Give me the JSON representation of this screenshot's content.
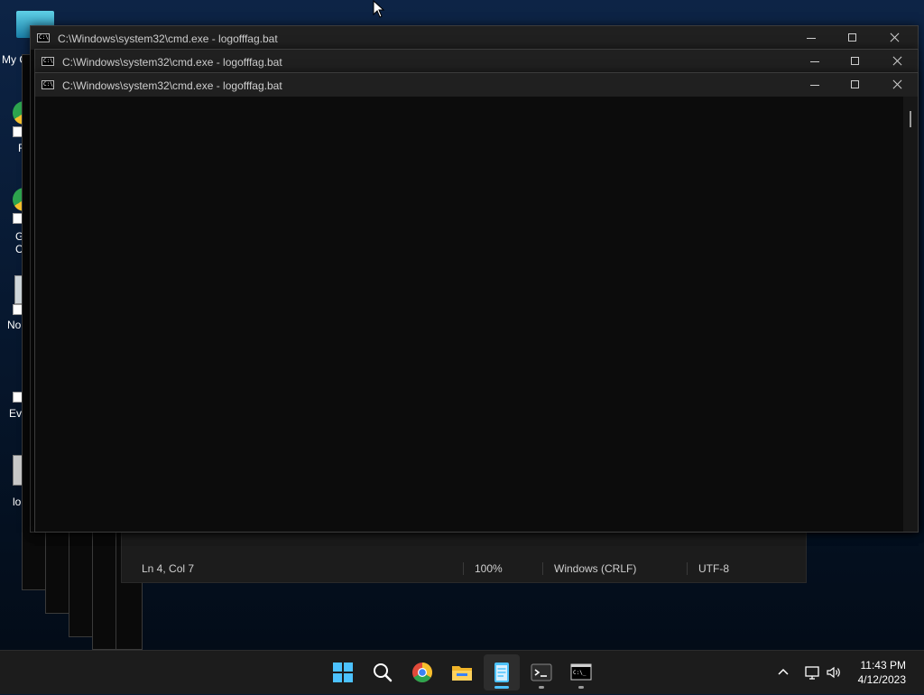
{
  "desktop": {
    "icons": [
      {
        "name": "my-computer",
        "label": "My C"
      },
      {
        "name": "chrome-shortcut-1",
        "label": "F"
      },
      {
        "name": "chrome-shortcut-2",
        "label": "G\nC"
      },
      {
        "name": "notepad-shortcut",
        "label": "No"
      },
      {
        "name": "event-shortcut",
        "label": "Eve"
      },
      {
        "name": "logoff-shortcut",
        "label": "lo"
      }
    ]
  },
  "cmd_windows": [
    {
      "title": "C:\\Windows\\system32\\cmd.exe - logofffag.bat"
    },
    {
      "title": "C:\\Windows\\system32\\cmd.exe - logofffag.bat"
    },
    {
      "title": "C:\\Windows\\system32\\cmd.exe - logofffag.bat"
    }
  ],
  "notepad": {
    "status": {
      "position": "Ln 4, Col 7",
      "zoom": "100%",
      "line_ending": "Windows (CRLF)",
      "encoding": "UTF-8"
    }
  },
  "taskbar": {
    "apps": [
      {
        "name": "start",
        "icon": "windows-logo-icon"
      },
      {
        "name": "search",
        "icon": "search-icon"
      },
      {
        "name": "chrome",
        "icon": "chrome-icon"
      },
      {
        "name": "file-explorer",
        "icon": "folder-icon"
      },
      {
        "name": "notepad",
        "icon": "notepad-icon",
        "active": true
      },
      {
        "name": "terminal",
        "icon": "terminal-icon"
      },
      {
        "name": "cmd",
        "icon": "cmd-icon"
      }
    ],
    "clock": {
      "time": "11:43 PM",
      "date": "4/12/2023"
    }
  },
  "colors": {
    "accent": "#4cc2ff",
    "console_bg": "#0c0c0c",
    "titlebar_bg": "#202020"
  }
}
